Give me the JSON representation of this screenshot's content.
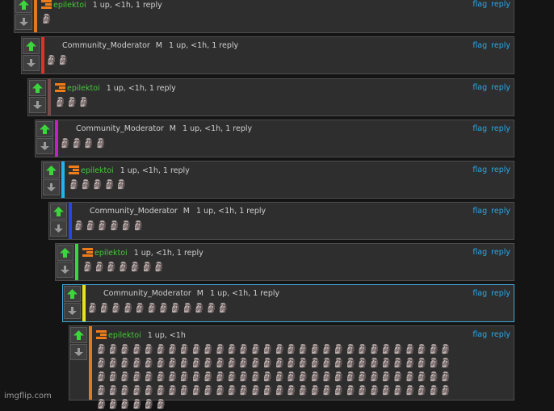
{
  "comments": [
    {
      "kind": "user",
      "user": "epilektoi",
      "badge": "",
      "meta": "1 up, <1h, 1 reply",
      "body": "🗿",
      "bar": "#e07a1f",
      "upvote": "upvote-arrow-icon",
      "downvote": "downvote-arrow-icon",
      "flag": "flag",
      "reply": "reply",
      "selected": false
    },
    {
      "kind": "mod",
      "user": "Community_Moderator",
      "badge": "M",
      "meta": "1 up, <1h, 1 reply",
      "body": "🗿🗿",
      "bar": "#e0302a",
      "flag": "flag",
      "reply": "reply",
      "selected": false
    },
    {
      "kind": "user",
      "user": "epilektoi",
      "badge": "",
      "meta": "1 up, <1h, 1 reply",
      "body": "🗿🗿🗿",
      "bar": "#7a4a4a",
      "flag": "flag",
      "reply": "reply",
      "selected": false
    },
    {
      "kind": "mod",
      "user": "Community_Moderator",
      "badge": "M",
      "meta": "1 up, <1h, 1 reply",
      "body": "🗿🗿🗿🗿",
      "bar": "#c41ec4",
      "flag": "flag",
      "reply": "reply",
      "selected": false
    },
    {
      "kind": "user",
      "user": "epilektoi",
      "badge": "",
      "meta": "1 up, <1h, 1 reply",
      "body": "🗿🗿🗿🗿🗿",
      "bar": "#22b5e8",
      "flag": "flag",
      "reply": "reply",
      "selected": false
    },
    {
      "kind": "mod",
      "user": "Community_Moderator",
      "badge": "M",
      "meta": "1 up, <1h, 1 reply",
      "body": "🗿🗿🗿🗿🗿🗿",
      "bar": "#2a43e6",
      "flag": "flag",
      "reply": "reply",
      "selected": false
    },
    {
      "kind": "user",
      "user": "epilektoi",
      "badge": "",
      "meta": "1 up, <1h, 1 reply",
      "body": "🗿🗿🗿🗿🗿🗿🗿",
      "bar": "#38d838",
      "flag": "flag",
      "reply": "reply",
      "selected": false
    },
    {
      "kind": "mod",
      "user": "Community_Moderator",
      "badge": "M",
      "meta": "1 up, <1h, 1 reply",
      "body": "🗿🗿🗿🗿🗿🗿🗿🗿🗿🗿🗿🗿",
      "bar": "#e4e41a",
      "flag": "flag",
      "reply": "reply",
      "selected": true
    },
    {
      "kind": "user",
      "user": "epilektoi",
      "badge": "",
      "meta": "1 up, <1h",
      "body": "🗿🗿🗿🗿🗿🗿🗿🗿🗿🗿🗿🗿🗿🗿🗿🗿🗿🗿🗿🗿🗿🗿🗿🗿🗿🗿🗿🗿🗿🗿\n🗿🗿🗿🗿🗿🗿🗿🗿🗿🗿🗿🗿🗿🗿🗿🗿🗿🗿🗿🗿🗿🗿🗿🗿🗿🗿🗿🗿🗿🗿\n🗿🗿🗿🗿🗿🗿🗿🗿🗿🗿🗿🗿🗿🗿🗿🗿🗿🗿🗿🗿🗿🗿🗿🗿🗿🗿🗿🗿🗿🗿\n🗿🗿🗿🗿🗿🗿🗿🗿🗿🗿🗿🗿🗿🗿🗿🗿🗿🗿🗿🗿🗿🗿🗿🗿🗿🗿🗿🗿🗿🗿\n🗿🗿🗿🗿🗿🗿",
      "bar": "#e07a1f",
      "flag": "flag",
      "reply": "reply",
      "selected": false
    }
  ],
  "icons": {
    "flair": "flair-icon",
    "upvote": "upvote-arrow-icon",
    "downvote": "downvote-arrow-icon"
  },
  "colors": {
    "upvote": "#3bd63b",
    "downvote": "#9a9a9a",
    "username": "#45c837",
    "link": "#2aa7e6",
    "flair": "#f07c17"
  },
  "watermark": "imgflip.com"
}
